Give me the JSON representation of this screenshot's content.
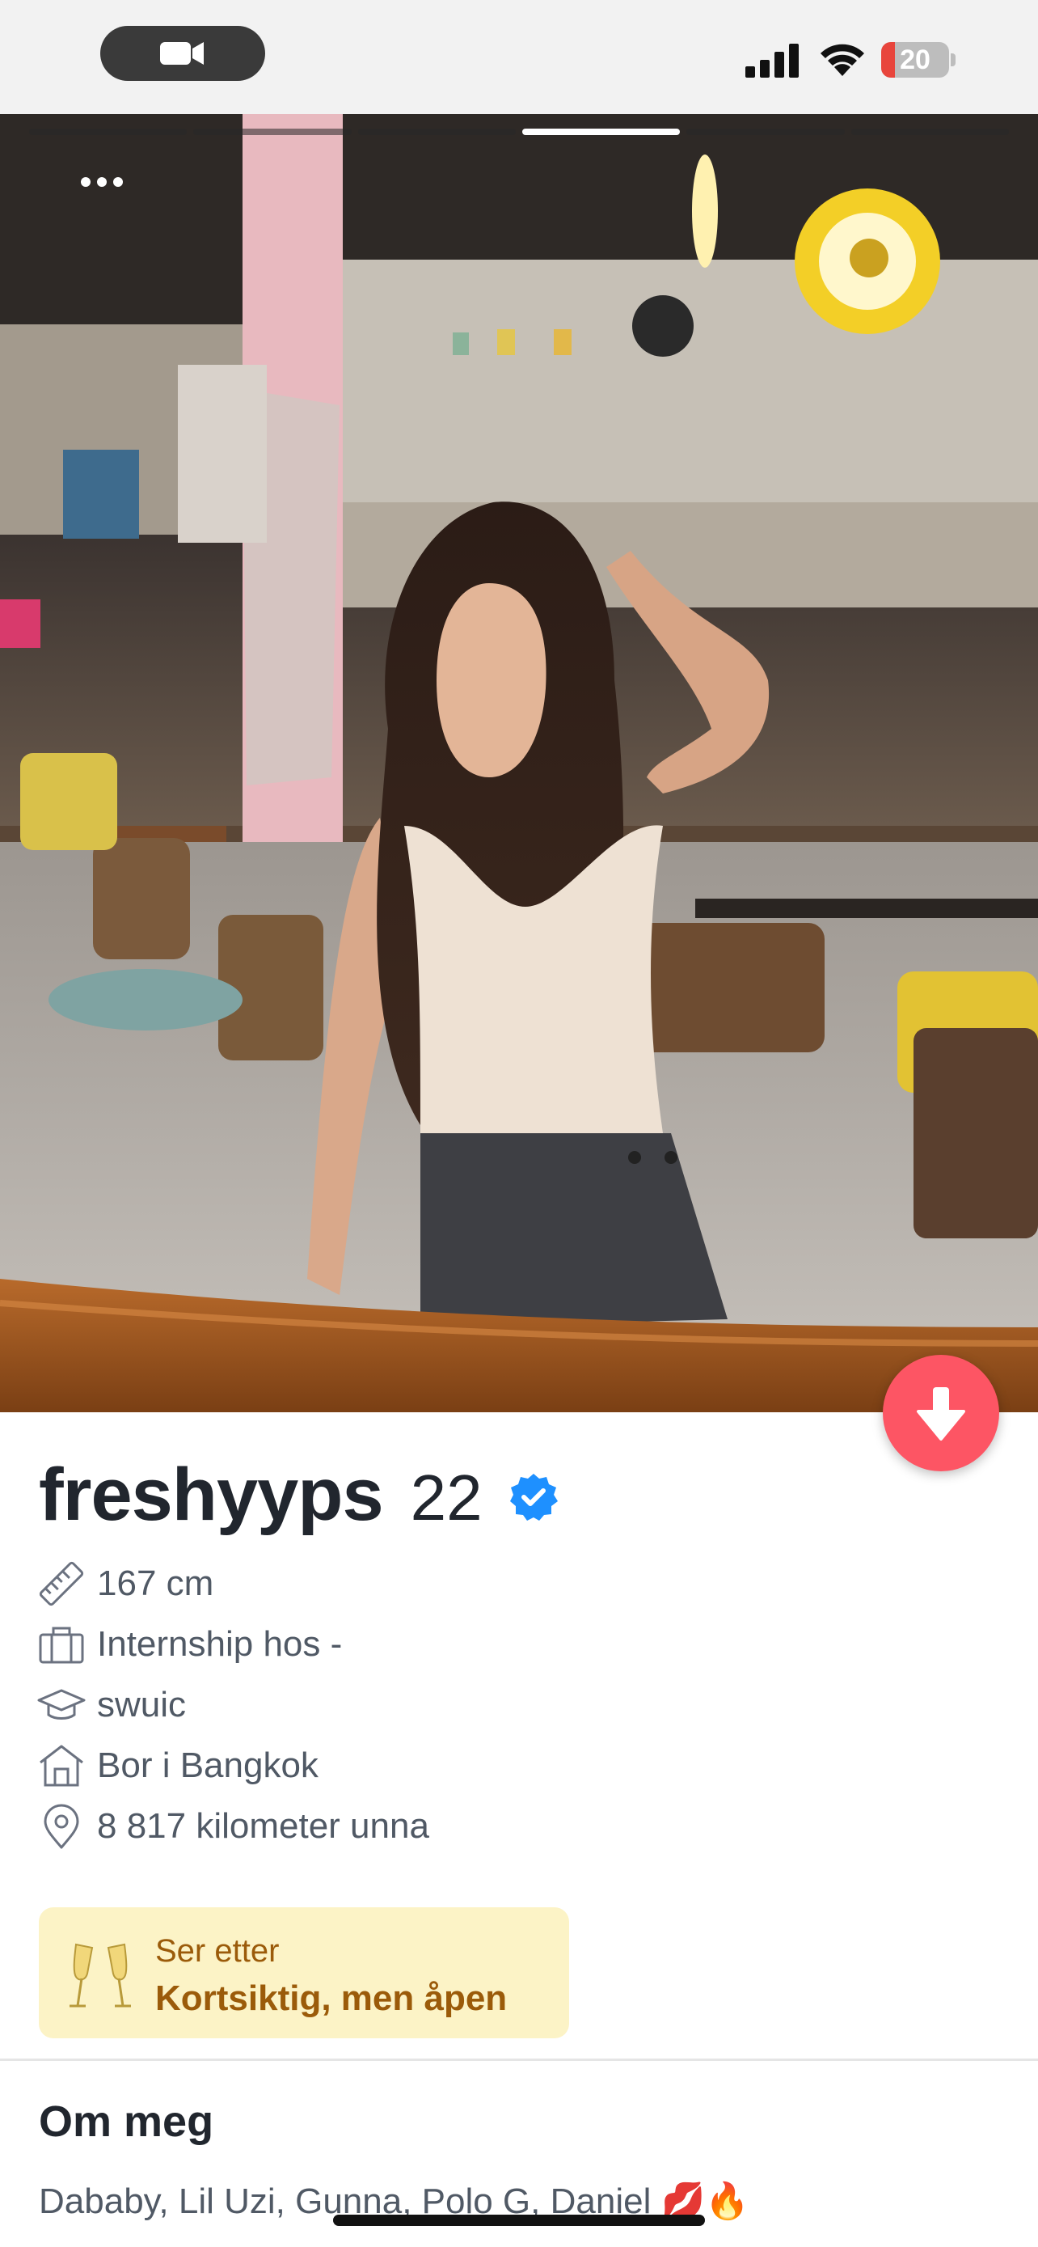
{
  "status_bar": {
    "battery_level": "20",
    "battery_fraction": 0.2,
    "battery_color": "#e8453c",
    "icons": [
      "video-camera-icon",
      "signal-icon",
      "wifi-icon",
      "battery-icon"
    ]
  },
  "photo": {
    "page_count": 6,
    "active_page": 4,
    "more_icon": "more-dots-icon",
    "scroll_icon": "arrow-down-icon"
  },
  "profile": {
    "name": "freshyyps",
    "age": "22",
    "verified": true,
    "info": [
      {
        "icon": "ruler-icon",
        "text": "167 cm"
      },
      {
        "icon": "briefcase-icon",
        "text": "Internship hos -"
      },
      {
        "icon": "graduation-cap-icon",
        "text": "swuic"
      },
      {
        "icon": "house-icon",
        "text": "Bor i Bangkok"
      },
      {
        "icon": "location-pin-icon",
        "text": "8 817 kilometer unna"
      }
    ]
  },
  "looking_for": {
    "label": "Ser etter",
    "value": "Kortsiktig, men åpen",
    "icon": "champagne-glasses-icon"
  },
  "about": {
    "title": "Om meg",
    "text": "Dababy, Lil Uzi, Gunna, Polo G, Daniel 💋🔥"
  },
  "colors": {
    "accent": "#fd5564",
    "verified": "#1e90ff",
    "looking_bg": "#fcf3c6",
    "looking_text": "#9b5b0a"
  }
}
